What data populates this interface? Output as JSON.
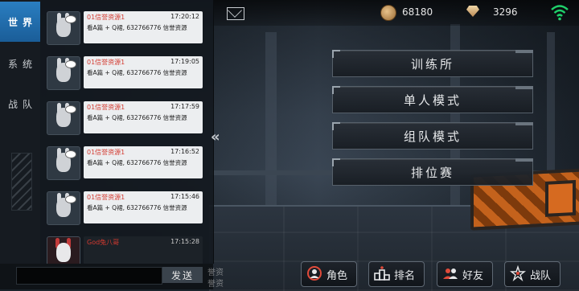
{
  "topbar": {
    "coins": "68180",
    "gems": "3296",
    "icons": [
      "mail-icon",
      "coin-icon",
      "gem-icon",
      "wifi-icon"
    ]
  },
  "chat": {
    "tabs": [
      {
        "label": "世界",
        "active": true
      },
      {
        "label": "系统",
        "active": false
      },
      {
        "label": "战队",
        "active": false
      }
    ],
    "messages": [
      {
        "name": "01信誉资源1",
        "time": "17:20:12",
        "text": "看A篇 + Q裙, 632766776 信誉资源",
        "avatar": "bunny"
      },
      {
        "name": "01信誉资源1",
        "time": "17:19:05",
        "text": "看A篇 + Q裙, 632766776 信誉资源",
        "avatar": "bunny"
      },
      {
        "name": "01信誉资源1",
        "time": "17:17:59",
        "text": "看A篇 + Q裙, 632766776 信誉资源",
        "avatar": "bunny"
      },
      {
        "name": "01信誉资源1",
        "time": "17:16:52",
        "text": "看A篇 + Q裙, 632766776 信誉资源",
        "avatar": "bunny"
      },
      {
        "name": "01信誉资源1",
        "time": "17:15:46",
        "text": "看A篇 + Q裙, 632766776 信誉资源",
        "avatar": "bunny"
      },
      {
        "name": "God兔八哥",
        "time": "17:15:28",
        "text": "",
        "avatar": "red"
      }
    ],
    "send_label": "发送",
    "ghost_text_1": "誉资",
    "ghost_text_2": "誉资"
  },
  "menu": {
    "training": "训练所",
    "single": "单人模式",
    "team": "组队模式",
    "ranked": "排位赛"
  },
  "bottom": {
    "character": "角色",
    "rank": "排名",
    "friends": "好友",
    "clan": "战队"
  },
  "colors": {
    "accent_blue": "#2a7ec1",
    "name_red": "#d3392f",
    "wifi_green": "#1fd06a"
  }
}
